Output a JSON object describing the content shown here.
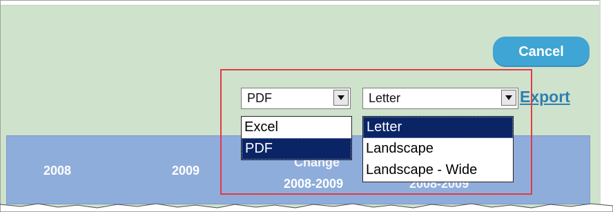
{
  "actions": {
    "cancel_label": "Cancel",
    "export_label": "Export"
  },
  "export_controls": {
    "format_select": {
      "selected": "PDF",
      "options": [
        "Excel",
        "PDF"
      ]
    },
    "page_select": {
      "selected": "Letter",
      "options": [
        "Letter",
        "Landscape",
        "Landscape - Wide"
      ]
    }
  },
  "table": {
    "year_headers": [
      "2008",
      "2009"
    ],
    "change_label_partial": "Change",
    "change_range_1": "2008-2009",
    "change_range_2": "2008-2009"
  },
  "colors": {
    "page_background": "#cfe2cc",
    "header_background": "#8faddb",
    "cancel_button": "#3fa5d4",
    "link": "#2f7fb1",
    "highlight_box": "#e23a43",
    "selected_option": "#0b2466"
  }
}
